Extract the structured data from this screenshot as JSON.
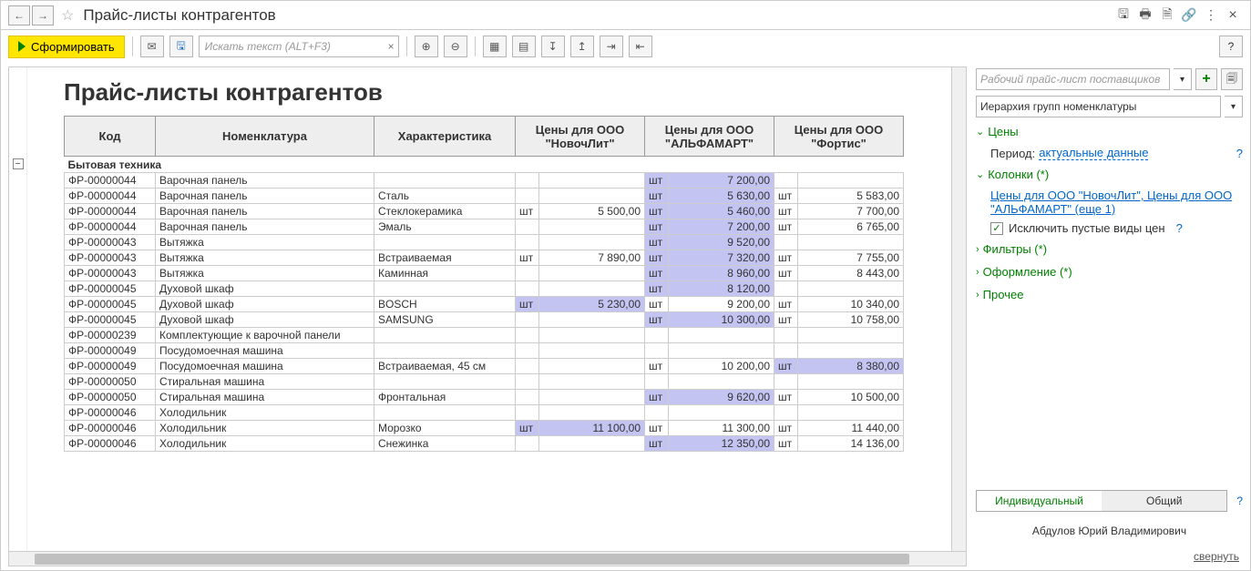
{
  "title": "Прайс-листы контрагентов",
  "toolbar": {
    "generate": "Сформировать",
    "search_placeholder": "Искать текст (ALT+F3)"
  },
  "report": {
    "title": "Прайс-листы контрагентов",
    "headers": {
      "code": "Код",
      "name": "Номенклатура",
      "char": "Характеристика",
      "p1": "Цены для ООО \"НовочЛит\"",
      "p2": "Цены для ООО \"АЛЬФАМАРТ\"",
      "p3": "Цены для ООО \"Фортис\""
    },
    "group": "Бытовая техника",
    "rows": [
      {
        "code": "ФР-00000044",
        "name": "Варочная панель",
        "char": "",
        "u1": "",
        "v1": "",
        "u2": "шт",
        "v2": "7 200,00",
        "u3": "",
        "v3": "",
        "hl": [
          2
        ]
      },
      {
        "code": "ФР-00000044",
        "name": "Варочная панель",
        "char": "Сталь",
        "u1": "",
        "v1": "",
        "u2": "шт",
        "v2": "5 630,00",
        "u3": "шт",
        "v3": "5 583,00",
        "hl": [
          2
        ]
      },
      {
        "code": "ФР-00000044",
        "name": "Варочная панель",
        "char": "Стеклокерамика",
        "u1": "шт",
        "v1": "5 500,00",
        "u2": "шт",
        "v2": "5 460,00",
        "u3": "шт",
        "v3": "7 700,00",
        "hl": [
          2
        ]
      },
      {
        "code": "ФР-00000044",
        "name": "Варочная панель",
        "char": "Эмаль",
        "u1": "",
        "v1": "",
        "u2": "шт",
        "v2": "7 200,00",
        "u3": "шт",
        "v3": "6 765,00",
        "hl": [
          2
        ]
      },
      {
        "code": "ФР-00000043",
        "name": "Вытяжка",
        "char": "",
        "u1": "",
        "v1": "",
        "u2": "шт",
        "v2": "9 520,00",
        "u3": "",
        "v3": "",
        "hl": [
          2
        ]
      },
      {
        "code": "ФР-00000043",
        "name": "Вытяжка",
        "char": "Встраиваемая",
        "u1": "шт",
        "v1": "7 890,00",
        "u2": "шт",
        "v2": "7 320,00",
        "u3": "шт",
        "v3": "7 755,00",
        "hl": [
          2
        ]
      },
      {
        "code": "ФР-00000043",
        "name": "Вытяжка",
        "char": "Каминная",
        "u1": "",
        "v1": "",
        "u2": "шт",
        "v2": "8 960,00",
        "u3": "шт",
        "v3": "8 443,00",
        "hl": [
          2
        ]
      },
      {
        "code": "ФР-00000045",
        "name": "Духовой шкаф",
        "char": "",
        "u1": "",
        "v1": "",
        "u2": "шт",
        "v2": "8 120,00",
        "u3": "",
        "v3": "",
        "hl": [
          2
        ]
      },
      {
        "code": "ФР-00000045",
        "name": "Духовой шкаф",
        "char": "BOSCH",
        "u1": "шт",
        "v1": "5 230,00",
        "u2": "шт",
        "v2": "9 200,00",
        "u3": "шт",
        "v3": "10 340,00",
        "hl": [
          1
        ]
      },
      {
        "code": "ФР-00000045",
        "name": "Духовой шкаф",
        "char": "SAMSUNG",
        "u1": "",
        "v1": "",
        "u2": "шт",
        "v2": "10 300,00",
        "u3": "шт",
        "v3": "10 758,00",
        "hl": [
          2
        ]
      },
      {
        "code": "ФР-00000239",
        "name": "Комплектующие к варочной панели",
        "char": "",
        "u1": "",
        "v1": "",
        "u2": "",
        "v2": "",
        "u3": "",
        "v3": "",
        "hl": []
      },
      {
        "code": "ФР-00000049",
        "name": "Посудомоечная машина",
        "char": "",
        "u1": "",
        "v1": "",
        "u2": "",
        "v2": "",
        "u3": "",
        "v3": "",
        "hl": []
      },
      {
        "code": "ФР-00000049",
        "name": "Посудомоечная машина",
        "char": "Встраиваемая, 45 см",
        "u1": "",
        "v1": "",
        "u2": "шт",
        "v2": "10 200,00",
        "u3": "шт",
        "v3": "8 380,00",
        "hl": [
          3
        ]
      },
      {
        "code": "ФР-00000050",
        "name": "Стиральная машина",
        "char": "",
        "u1": "",
        "v1": "",
        "u2": "",
        "v2": "",
        "u3": "",
        "v3": "",
        "hl": []
      },
      {
        "code": "ФР-00000050",
        "name": "Стиральная машина",
        "char": "Фронтальная",
        "u1": "",
        "v1": "",
        "u2": "шт",
        "v2": "9 620,00",
        "u3": "шт",
        "v3": "10 500,00",
        "hl": [
          2
        ]
      },
      {
        "code": "ФР-00000046",
        "name": "Холодильник",
        "char": "",
        "u1": "",
        "v1": "",
        "u2": "",
        "v2": "",
        "u3": "",
        "v3": "",
        "hl": []
      },
      {
        "code": "ФР-00000046",
        "name": "Холодильник",
        "char": "Морозко",
        "u1": "шт",
        "v1": "11 100,00",
        "u2": "шт",
        "v2": "11 300,00",
        "u3": "шт",
        "v3": "11 440,00",
        "hl": [
          1
        ]
      },
      {
        "code": "ФР-00000046",
        "name": "Холодильник",
        "char": "Снежинка",
        "u1": "",
        "v1": "",
        "u2": "шт",
        "v2": "12 350,00",
        "u3": "шт",
        "v3": "14 136,00",
        "hl": [
          2
        ]
      }
    ]
  },
  "side": {
    "combo1": "Рабочий прайс-лист поставщиков",
    "combo2": "Иерархия групп номенклатуры",
    "sec_prices": "Цены",
    "period_label": "Период:",
    "period_value": "актуальные данные",
    "sec_columns": "Колонки (*)",
    "columns_link": "Цены для ООО \"НовочЛит\", Цены для ООО \"АЛЬФАМАРТ\" (еще 1)",
    "exclude_empty": "Исключить пустые виды цен",
    "sec_filters": "Фильтры (*)",
    "sec_design": "Оформление (*)",
    "sec_other": "Прочее",
    "view_individual": "Индивидуальный",
    "view_common": "Общий",
    "user": "Абдулов Юрий Владимирович",
    "collapse": "свернуть",
    "q": "?"
  }
}
